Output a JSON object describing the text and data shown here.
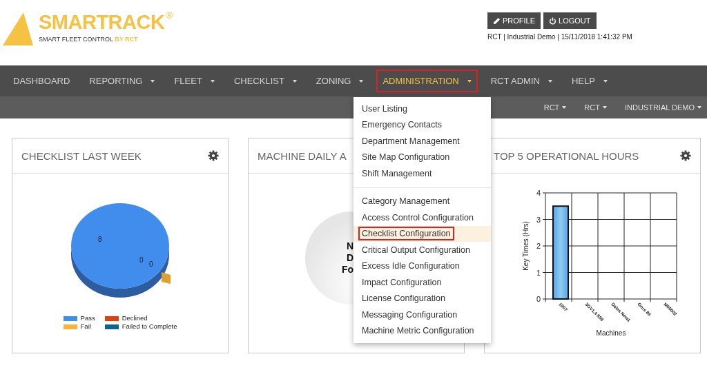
{
  "brand": {
    "name": "SMARTRACK",
    "mark": "®",
    "tagline": "SMART FLEET CONTROL",
    "tagline_by": "BY RCT"
  },
  "header_buttons": [
    {
      "kind": "profile",
      "label": "PROFILE"
    },
    {
      "kind": "logout",
      "label": "LOGOUT"
    }
  ],
  "session_info": "RCT | Industrial Demo | 15/11/2018 1:41:32 PM",
  "nav": [
    {
      "label": "DASHBOARD",
      "dropdown": false,
      "selected": false,
      "outlined": false
    },
    {
      "label": "REPORTING",
      "dropdown": true,
      "selected": false,
      "outlined": false
    },
    {
      "label": "FLEET",
      "dropdown": true,
      "selected": false,
      "outlined": false
    },
    {
      "label": "CHECKLIST",
      "dropdown": true,
      "selected": false,
      "outlined": false
    },
    {
      "label": "ZONING",
      "dropdown": true,
      "selected": false,
      "outlined": false
    },
    {
      "label": "ADMINISTRATION",
      "dropdown": true,
      "selected": true,
      "outlined": true
    },
    {
      "label": "RCT ADMIN",
      "dropdown": true,
      "selected": false,
      "outlined": false
    },
    {
      "label": "HELP",
      "dropdown": true,
      "selected": false,
      "outlined": false
    }
  ],
  "sub_nav": [
    "RCT",
    "RCT",
    "INDUSTRIAL DEMO"
  ],
  "admin_menu": [
    [
      {
        "label": "User Listing",
        "selected": false,
        "outlined": false
      },
      {
        "label": "Emergency Contacts",
        "selected": false,
        "outlined": false
      },
      {
        "label": "Department Management",
        "selected": false,
        "outlined": false
      },
      {
        "label": "Site Map Configuration",
        "selected": false,
        "outlined": false
      },
      {
        "label": "Shift Management",
        "selected": false,
        "outlined": false
      }
    ],
    [
      {
        "label": "Category Management",
        "selected": false,
        "outlined": false
      },
      {
        "label": "Access Control Configuration",
        "selected": false,
        "outlined": false
      },
      {
        "label": "Checklist Configuration",
        "selected": true,
        "outlined": true
      },
      {
        "label": "Critical Output Configuration",
        "selected": false,
        "outlined": false
      },
      {
        "label": "Excess Idle Configuration",
        "selected": false,
        "outlined": false
      },
      {
        "label": "Impact Configuration",
        "selected": false,
        "outlined": false
      },
      {
        "label": "License Configuration",
        "selected": false,
        "outlined": false
      },
      {
        "label": "Messaging Configuration",
        "selected": false,
        "outlined": false
      },
      {
        "label": "Machine Metric Configuration",
        "selected": false,
        "outlined": false
      }
    ]
  ],
  "cards": [
    {
      "kind": "pie",
      "title": "CHECKLIST LAST WEEK",
      "settings": true,
      "pie": {
        "value_labels": [
          "8",
          "0",
          "0"
        ],
        "legend": [
          {
            "label": "Pass",
            "color": "#418ded"
          },
          {
            "label": "Fail",
            "color": "#fbb040"
          },
          {
            "label": "Declined",
            "color": "#e0400f"
          },
          {
            "label": "Failed to Complete",
            "color": "#0d6490"
          }
        ]
      }
    },
    {
      "kind": "empty",
      "title": "MACHINE DAILY A",
      "message_lines": [
        "N",
        "D",
        "Fo"
      ]
    },
    {
      "kind": "bar",
      "title": "TOP 5 OPERATIONAL HOURS",
      "settings": true,
      "chart_data": {
        "type": "bar",
        "categories": [
          "1907",
          "3GV1.4 858",
          "Dales New1",
          "Grus 89",
          "M00002"
        ],
        "values": [
          3.5,
          0,
          0,
          0,
          0
        ],
        "ylim": [
          0,
          4
        ],
        "grid": true,
        "yticks": [
          0,
          1,
          2,
          3,
          4
        ],
        "xlabel": "Machines",
        "ylabel": "Key Times (Hrs)"
      }
    }
  ]
}
